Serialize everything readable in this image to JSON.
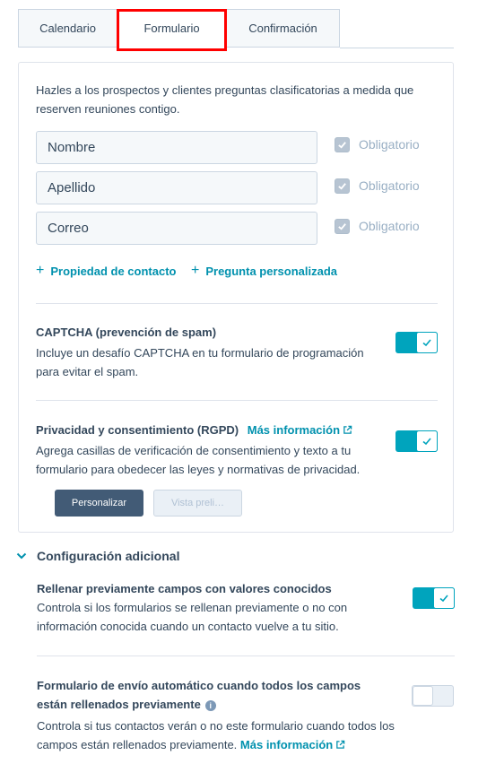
{
  "tabs": [
    {
      "label": "Calendario",
      "active": false
    },
    {
      "label": "Formulario",
      "active": true
    },
    {
      "label": "Confirmación",
      "active": false
    }
  ],
  "form_panel": {
    "intro": "Hazles a los prospectos y clientes preguntas clasificatorias a medida que reserven reuniones contigo.",
    "fields": [
      {
        "value": "Nombre",
        "required_label": "Obligatorio",
        "required": true
      },
      {
        "value": "Apellido",
        "required_label": "Obligatorio",
        "required": true
      },
      {
        "value": "Correo",
        "required_label": "Obligatorio",
        "required": true
      }
    ],
    "add_contact_property": "Propiedad de contacto",
    "add_custom_question": "Pregunta personalizada",
    "captcha": {
      "title": "CAPTCHA (prevención de spam)",
      "description": "Incluye un desafío CAPTCHA en tu formulario de programación para evitar el spam.",
      "enabled": true
    },
    "privacy": {
      "title": "Privacidad y consentimiento (RGPD)",
      "more_info": "Más información",
      "description": "Agrega casillas de verificación de consentimiento y texto a tu formulario para obedecer las leyes y normativas de privacidad.",
      "enabled": true,
      "customize_button": "Personalizar",
      "preview_button": "Vista preli…"
    }
  },
  "additional": {
    "heading": "Configuración adicional",
    "prefill": {
      "title": "Rellenar previamente campos con valores conocidos",
      "description": "Controla si los formularios se rellenan previamente o no con información conocida cuando un contacto vuelve a tu sitio.",
      "enabled": true
    },
    "autosubmit": {
      "title": "Formulario de envío automático cuando todos los campos están rellenados previamente",
      "description": "Controla si tus contactos verán o no este formulario cuando todos los campos están rellenados previamente.",
      "more_info": "Más información",
      "enabled": false
    }
  },
  "colors": {
    "accent": "#00a4bd",
    "link": "#0091ae",
    "highlight": "#ff0000",
    "text": "#33475b"
  }
}
